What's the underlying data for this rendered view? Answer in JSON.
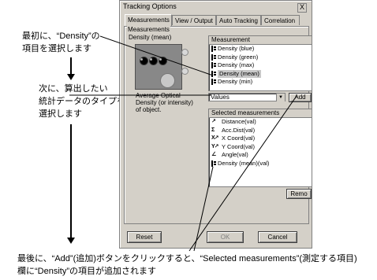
{
  "annotations": {
    "step1_line1": "最初に、“Density”の",
    "step1_line2": "項目を選択します",
    "step2_line1": "次に、算出したい",
    "step2_line2": "統計データのタイプを",
    "step2_line3": "選択します",
    "step3_line1": "最後に、“Add”(追加)ボタンをクリックすると、“Selected measurements”(測定する項目)",
    "step3_line2": "欄に“Density”の項目が追加されます"
  },
  "dialog": {
    "title": "Tracking Options",
    "close": "X",
    "tabs": [
      "Measurements",
      "View / Output",
      "Auto Tracking",
      "Correlation"
    ],
    "group_label": "Measurements",
    "selected_measure_title": "Density (mean)",
    "description": [
      "Average Optical",
      "Density (or intensity)",
      "of object."
    ],
    "measurement_header": "Measurement",
    "measurements": [
      {
        "label": "Density (blue)",
        "icon": "density-icon"
      },
      {
        "label": "Density (green)",
        "icon": "density-icon"
      },
      {
        "label": "Density (max)",
        "icon": "density-icon"
      },
      {
        "label": "Density (mean)",
        "icon": "density-icon",
        "selected": true
      },
      {
        "label": "Density (min)",
        "icon": "density-icon"
      }
    ],
    "stat_type_value": "Values",
    "add_button": "Add",
    "selected_header": "Selected measurements",
    "selected_measurements": [
      {
        "label": "Distance(val)",
        "icon": "distance-icon",
        "glyph": "↗"
      },
      {
        "label": "Acc.Dist(val)",
        "icon": "acc-distance-icon",
        "glyph": "Σ"
      },
      {
        "label": "X Coord(val)",
        "icon": "x-coord-icon",
        "glyph": "X↗"
      },
      {
        "label": "Y Coord(val)",
        "icon": "y-coord-icon",
        "glyph": "Y↗"
      },
      {
        "label": "Angle(val)",
        "icon": "angle-icon",
        "glyph": "∠"
      },
      {
        "label": "Density (mean)(val)",
        "icon": "density-icon",
        "glyph": ""
      }
    ],
    "remove_button": "Remo",
    "reset_button": "Reset",
    "ok_button": "OK",
    "cancel_button": "Cancel"
  }
}
